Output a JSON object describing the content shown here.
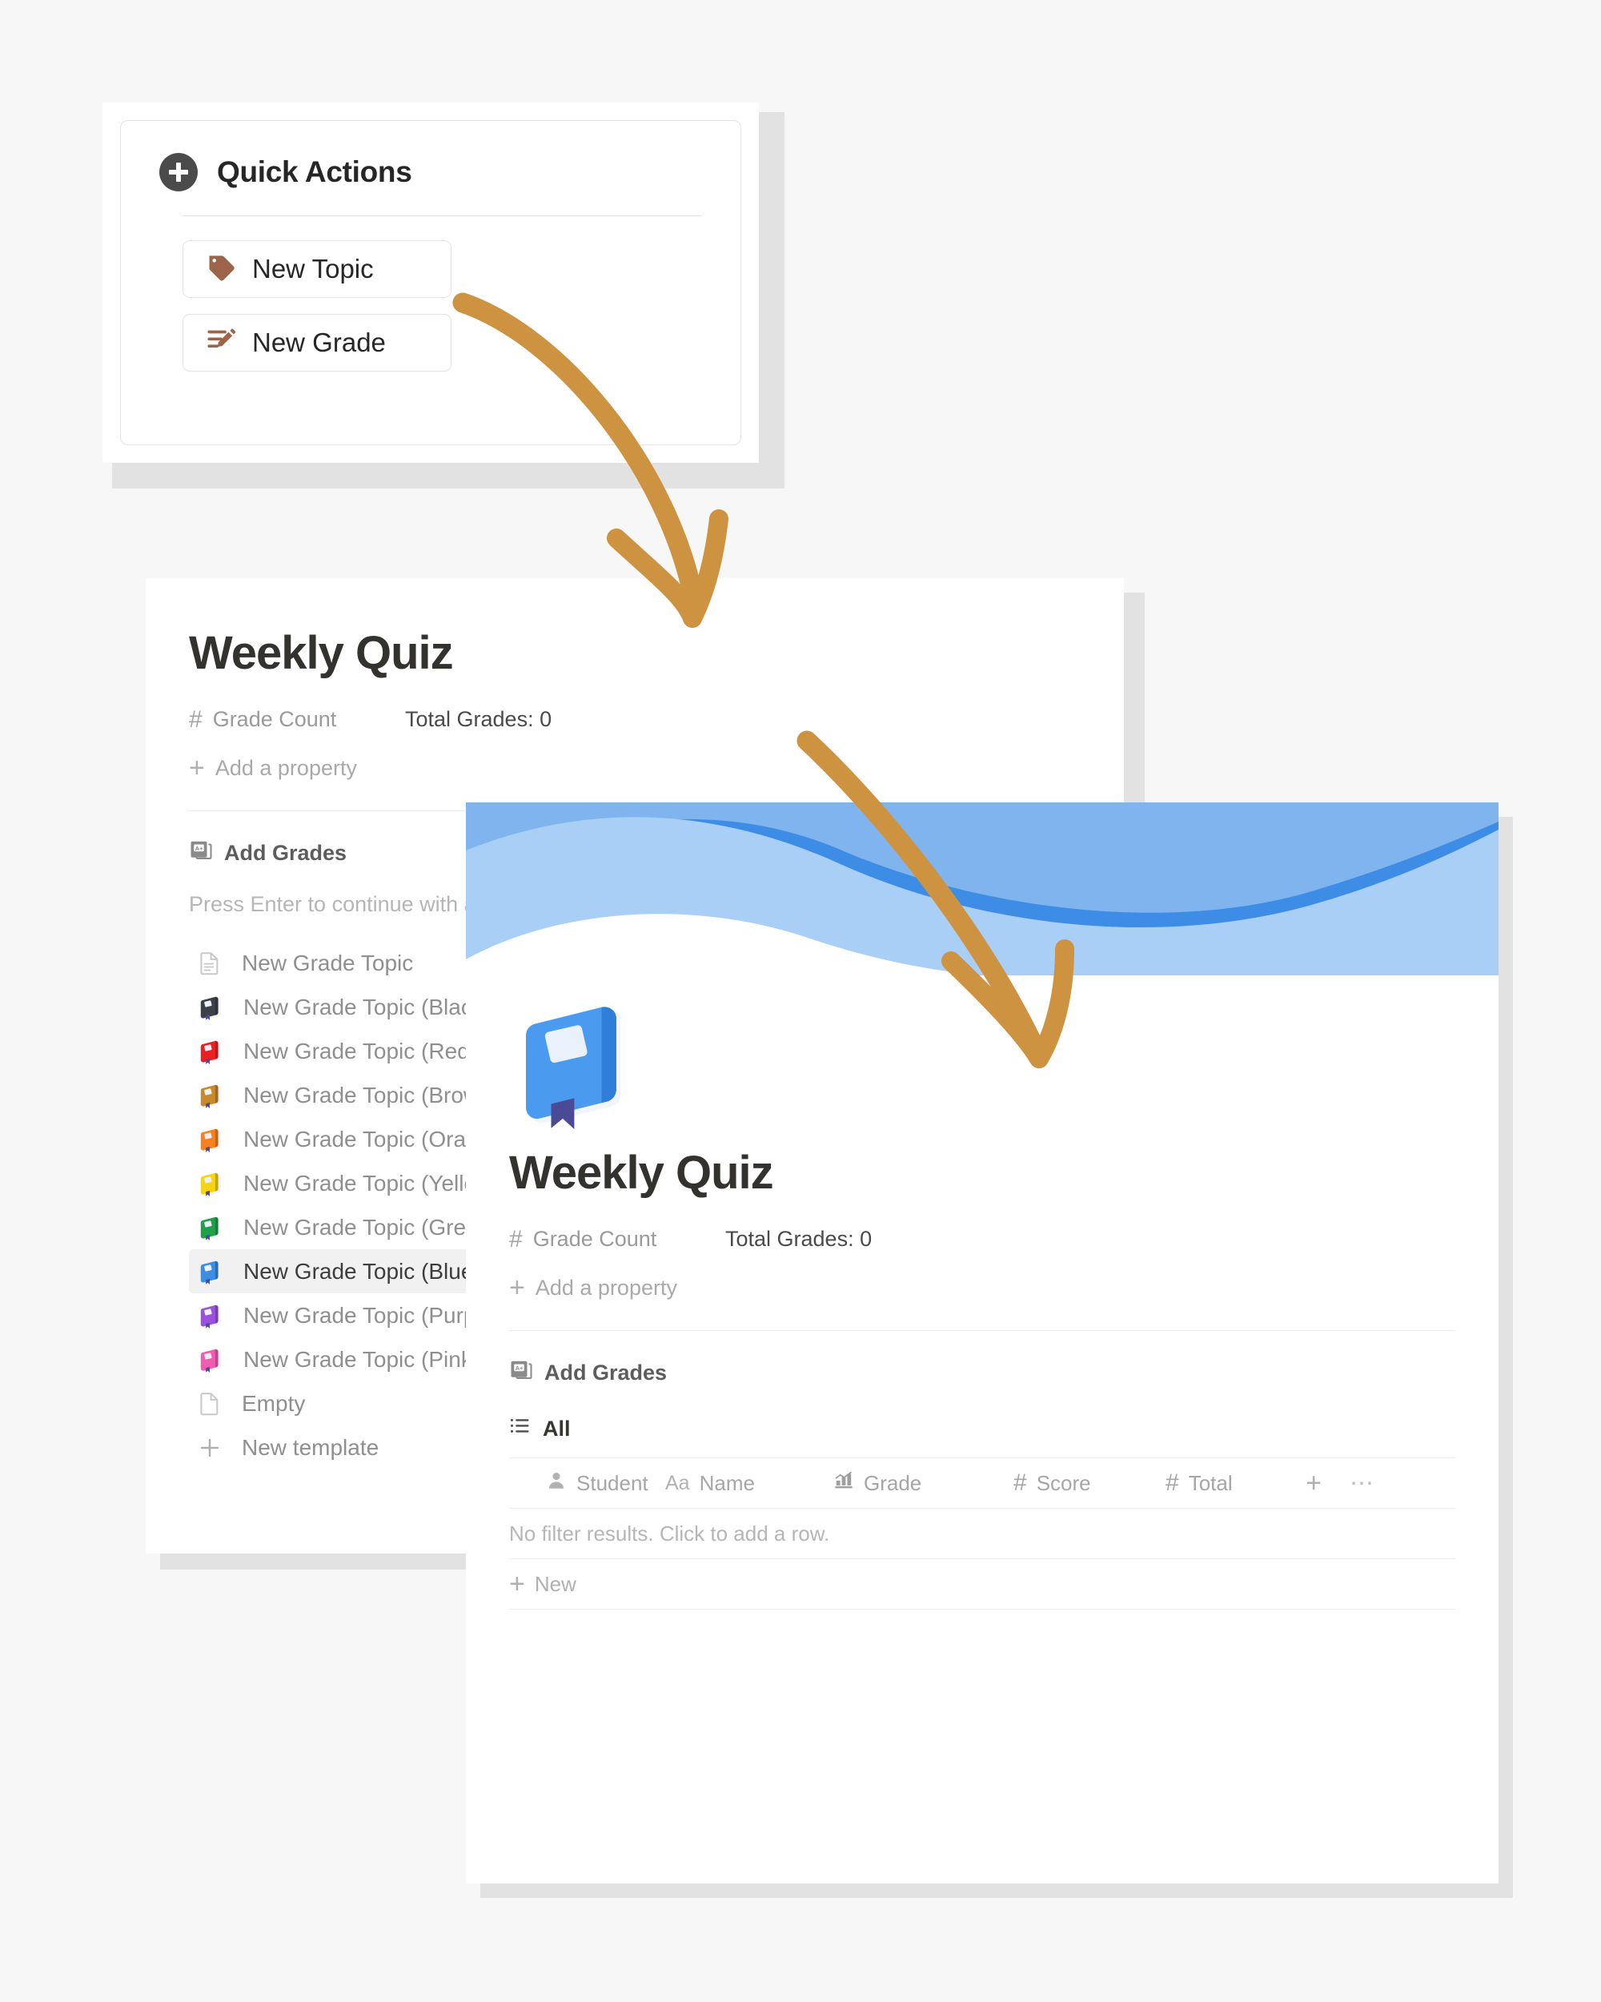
{
  "quick_actions": {
    "title": "Quick Actions",
    "add_icon": "plus-circle-icon",
    "buttons": [
      {
        "label": "New Topic",
        "icon": "tag-icon"
      },
      {
        "label": "New Grade",
        "icon": "list-edit-icon"
      }
    ]
  },
  "middle_page": {
    "title": "Weekly Quiz",
    "property": {
      "icon": "hash-icon",
      "key": "Grade Count",
      "value": "Total Grades: 0"
    },
    "add_property": "Add a property",
    "add_grades": "Add Grades",
    "add_grades_icon": "grade-book-icon",
    "hint": "Press Enter to continue with an empty page, or pick a template",
    "templates": [
      {
        "label": "New Grade Topic",
        "icon": "page-icon",
        "color": "none",
        "selected": false
      },
      {
        "label": "New Grade Topic (Black)",
        "icon": "book-icon",
        "color": "#3b4147",
        "selected": false
      },
      {
        "label": "New Grade Topic (Red)",
        "icon": "book-icon",
        "color": "#ec2024",
        "selected": false
      },
      {
        "label": "New Grade Topic (Brown)",
        "icon": "book-icon",
        "color": "#c98a2b",
        "selected": false
      },
      {
        "label": "New Grade Topic (Orange)",
        "icon": "book-icon",
        "color": "#f98020",
        "selected": false
      },
      {
        "label": "New Grade Topic (Yellow)",
        "icon": "book-icon",
        "color": "#f6d411",
        "selected": false
      },
      {
        "label": "New Grade Topic (Green)",
        "icon": "book-icon",
        "color": "#1fa14a",
        "selected": false
      },
      {
        "label": "New Grade Topic (Blue)",
        "icon": "book-icon",
        "color": "#3a8ee6",
        "selected": true
      },
      {
        "label": "New Grade Topic (Purple)",
        "icon": "book-icon",
        "color": "#9b51e0",
        "selected": false
      },
      {
        "label": "New Grade Topic (Pink)",
        "icon": "book-icon",
        "color": "#f25cb0",
        "selected": false
      },
      {
        "label": "Empty",
        "icon": "blank-page-icon",
        "color": "none",
        "selected": false
      },
      {
        "label": "New template",
        "icon": "plus-icon",
        "color": "none",
        "selected": false
      }
    ]
  },
  "detail_page": {
    "cover_icon": "blue-book-emoji",
    "banner_colors": [
      "#3d8ce6",
      "#7fb4ee",
      "#a9cff7",
      "#ffffff"
    ],
    "title": "Weekly Quiz",
    "property": {
      "icon": "hash-icon",
      "key": "Grade Count",
      "value": "Total Grades: 0"
    },
    "add_property": "Add a property",
    "add_grades": "Add Grades",
    "add_grades_icon": "grade-book-icon",
    "database": {
      "view_label": "All",
      "view_icon": "list-view-icon",
      "columns": [
        {
          "label": "Student",
          "icon": "person-icon"
        },
        {
          "label": "Name",
          "icon": "aa-icon"
        },
        {
          "label": "Grade",
          "icon": "bar-chart-icon"
        },
        {
          "label": "Score",
          "icon": "hash-icon"
        },
        {
          "label": "Total",
          "icon": "hash-icon"
        }
      ],
      "add_column_icon": "plus-icon",
      "more_icon": "ellipsis-icon",
      "empty_message": "No filter results. Click to add a row.",
      "new_row_label": "New"
    }
  },
  "annotations": {
    "arrow_color": "#ce9340",
    "arrows": [
      {
        "name": "arrow-new-topic-to-weekly-quiz"
      },
      {
        "name": "arrow-weekly-quiz-to-detail-page"
      }
    ]
  }
}
